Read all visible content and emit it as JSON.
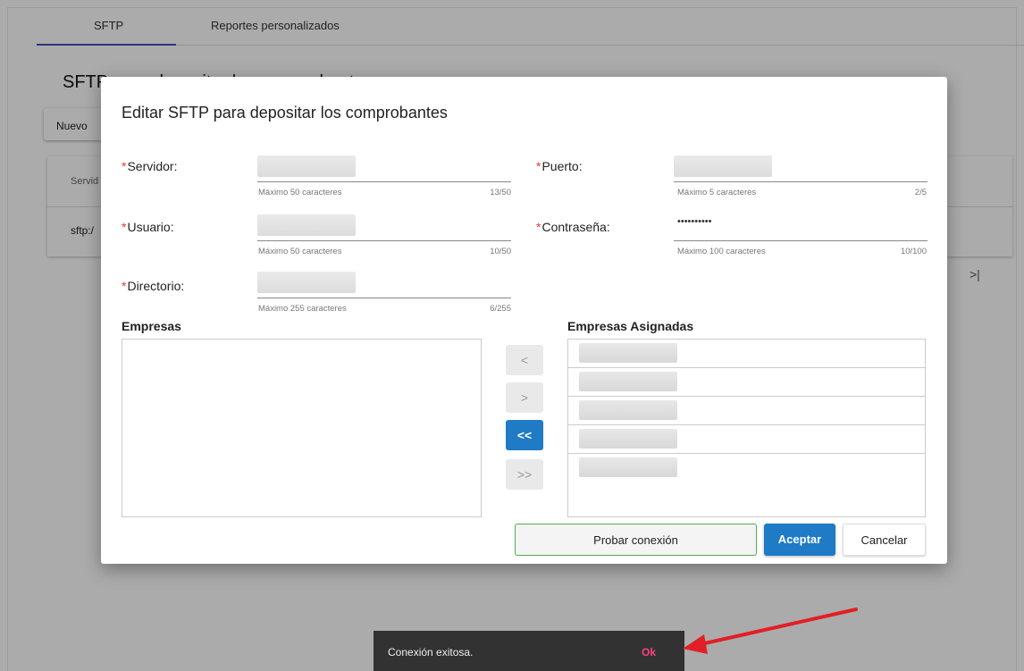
{
  "tabs": [
    "SFTP",
    "Reportes personalizados"
  ],
  "background": {
    "title": "SFTP para depositar los comprobantes",
    "new_button": "Nuevo",
    "table_header_partial": "Servid",
    "table_row_partial": "sftp:/",
    "last_page_icon": ">|"
  },
  "modal": {
    "title": "Editar SFTP para depositar los comprobantes",
    "required_marker": "*",
    "fields": {
      "servidor": {
        "label": "Servidor:",
        "hint": "Máximo 50 caracteres",
        "count": "13/50"
      },
      "puerto": {
        "label": "Puerto:",
        "hint": "Máximo 5 caracteres",
        "count": "2/5"
      },
      "usuario": {
        "label": "Usuario:",
        "hint": "Máximo 50 caracteres",
        "count": "10/50"
      },
      "contrasena": {
        "label": "Contraseña:",
        "value": "••••••••••",
        "hint": "Máximo 100 caracteres",
        "count": "10/100"
      },
      "directorio": {
        "label": "Directorio:",
        "hint": "Máximo 255 caracteres",
        "count": "6/255"
      }
    },
    "empresas_label": "Empresas",
    "empresas_asignadas_label": "Empresas Asignadas",
    "transfer_buttons": [
      "<",
      ">",
      "<<",
      ">>"
    ],
    "buttons": {
      "probar": "Probar conexión",
      "aceptar": "Aceptar",
      "cancelar": "Cancelar"
    }
  },
  "snackbar": {
    "message": "Conexión exitosa.",
    "action": "Ok"
  },
  "colors": {
    "primary": "#1f7bc6",
    "success_border": "#4caf50",
    "required": "#e53935",
    "snackbar_action": "#ff4081",
    "annotation_arrow": "#e21f26"
  }
}
